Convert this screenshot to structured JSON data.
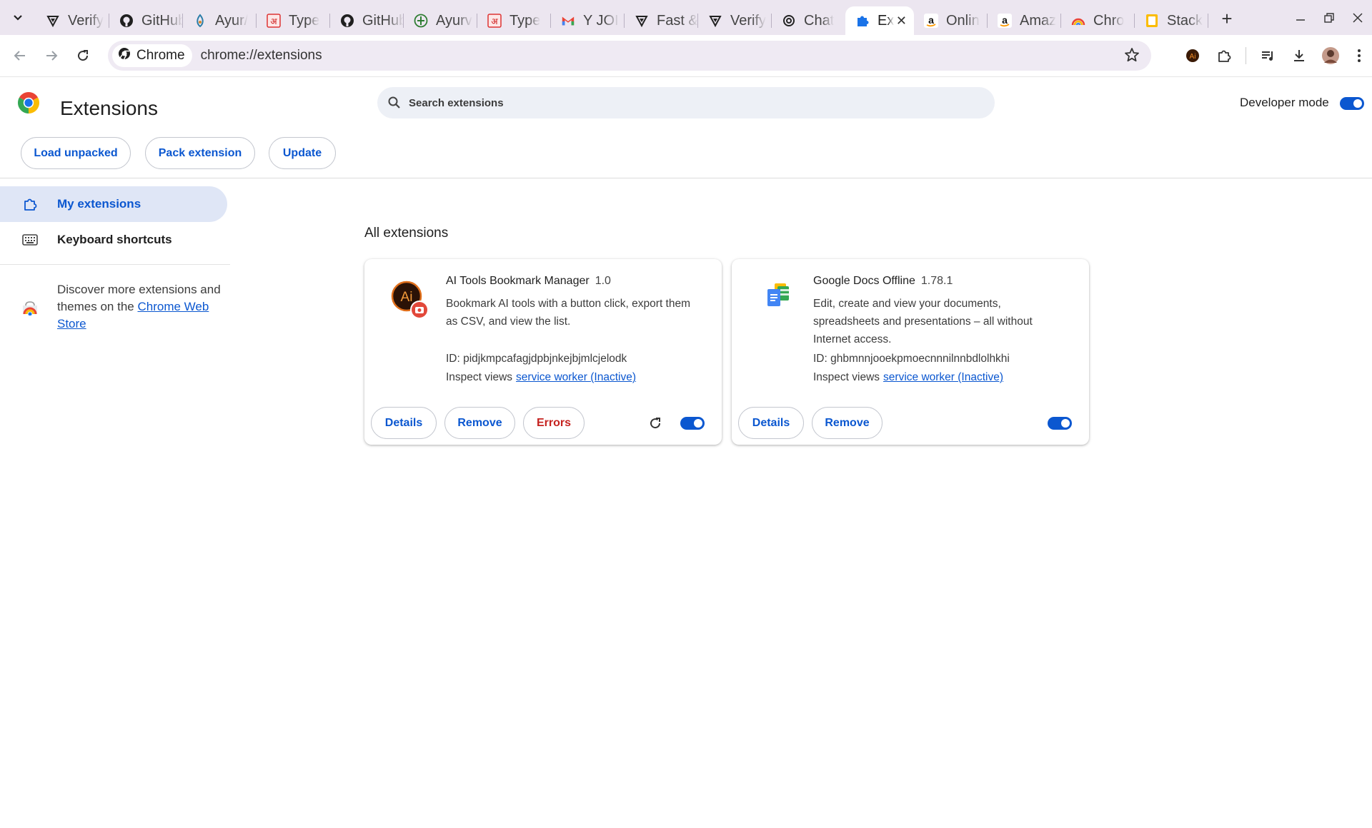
{
  "browser": {
    "tabs": [
      {
        "title": "Verify",
        "icon": "vercel-icon"
      },
      {
        "title": "GitHub",
        "icon": "github-icon"
      },
      {
        "title": "Ayur/",
        "icon": "ayur-icon"
      },
      {
        "title": "Type",
        "icon": "devanagari-icon"
      },
      {
        "title": "GitHub",
        "icon": "github-icon"
      },
      {
        "title": "Ayurv",
        "icon": "leaf-icon"
      },
      {
        "title": "Type",
        "icon": "devanagari-icon"
      },
      {
        "title": "Y JOI",
        "icon": "gmail-icon"
      },
      {
        "title": "Fast &",
        "icon": "vercel-icon"
      },
      {
        "title": "Verify",
        "icon": "vercel-icon"
      },
      {
        "title": "Chat",
        "icon": "openai-icon"
      },
      {
        "title": "Ex",
        "icon": "puzzle-icon",
        "active": true
      },
      {
        "title": "Onlin",
        "icon": "amazon-icon"
      },
      {
        "title": "Amaz",
        "icon": "amazon-icon"
      },
      {
        "title": "Chro",
        "icon": "rainbow-icon"
      },
      {
        "title": "Stack",
        "icon": "keep-icon"
      }
    ],
    "chip_label": "Chrome",
    "url": "chrome://extensions",
    "colors": {
      "tabstrip": "#ece6f0",
      "accent": "#0b57d0"
    }
  },
  "header": {
    "title": "Extensions",
    "search_placeholder": "Search extensions",
    "dev_mode_label": "Developer mode",
    "dev_mode_on": true,
    "buttons": {
      "load_unpacked": "Load unpacked",
      "pack_extension": "Pack extension",
      "update": "Update"
    }
  },
  "sidebar": {
    "items": [
      {
        "label": "My extensions",
        "icon": "extensions-icon",
        "active": true
      },
      {
        "label": "Keyboard shortcuts",
        "icon": "keyboard-icon",
        "active": false
      }
    ],
    "discover_text": "Discover more extensions and themes on the",
    "discover_link": "Chrome Web Store"
  },
  "main": {
    "section_title": "All extensions",
    "extensions": [
      {
        "name": "AI Tools Bookmark Manager",
        "version": "1.0",
        "description": "Bookmark AI tools with a button click, export them as CSV, and view the list.",
        "id_text": "ID: pidjkmpcafagjdpbjnkejbjmlcjelodk",
        "inspect_label": "Inspect views",
        "inspect_link": "service worker (Inactive)",
        "buttons": {
          "details": "Details",
          "remove": "Remove",
          "errors": "Errors"
        },
        "enabled": true
      },
      {
        "name": "Google Docs Offline",
        "version": "1.78.1",
        "description": "Edit, create and view your documents, spreadsheets and presentations – all without Internet access.",
        "id_text": "ID: ghbmnnjooekpmoecnnnilnnbdlolhkhi",
        "inspect_label": "Inspect views",
        "inspect_link": "service worker (Inactive)",
        "buttons": {
          "details": "Details",
          "remove": "Remove"
        },
        "enabled": true
      }
    ]
  }
}
